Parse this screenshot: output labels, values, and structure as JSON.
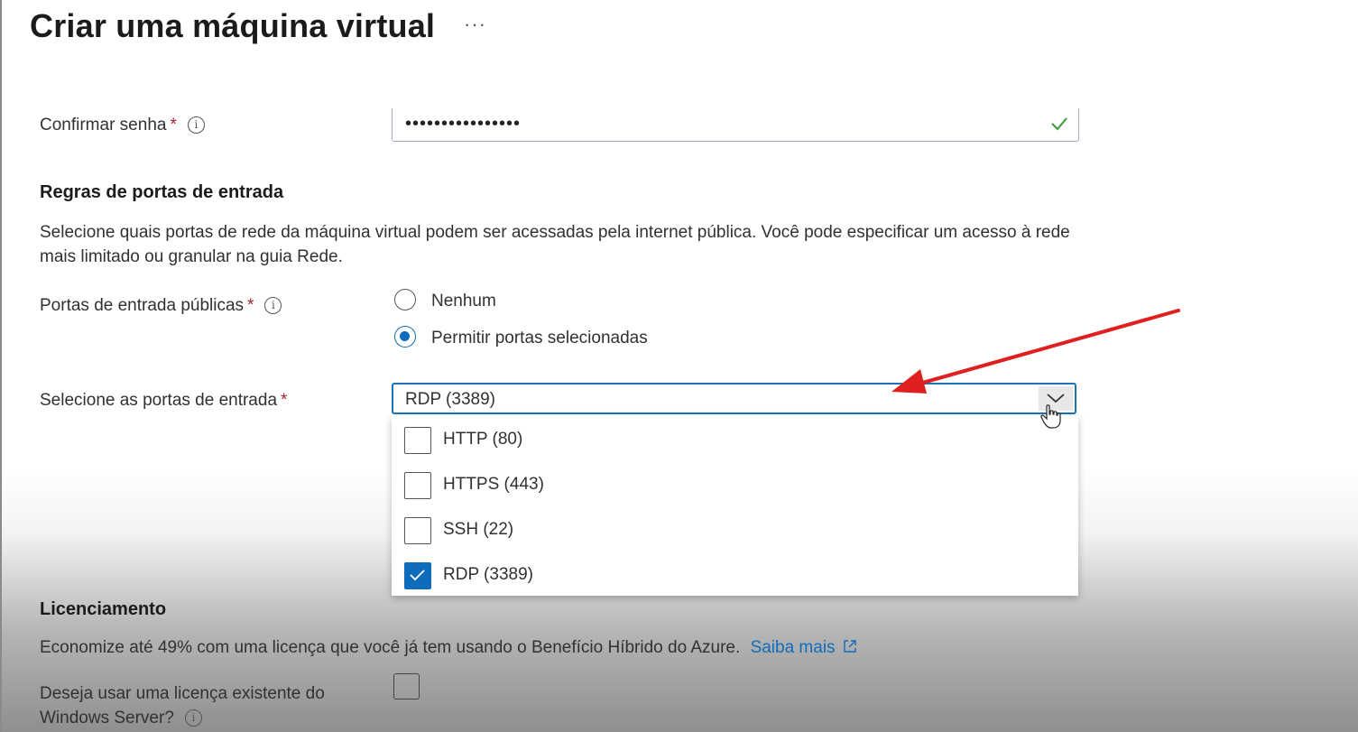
{
  "page": {
    "title": "Criar uma máquina virtual",
    "more_glyph": "···"
  },
  "confirm_password": {
    "label": "Confirmar senha",
    "required_mark": "*",
    "info_glyph": "i",
    "value": "••••••••••••••••"
  },
  "inbound_rules": {
    "heading": "Regras de portas de entrada",
    "description": "Selecione quais portas de rede da máquina virtual podem ser acessadas pela internet pública. Você pode especificar um acesso à rede mais limitado ou granular na guia Rede.",
    "public_ports": {
      "label": "Portas de entrada públicas",
      "required_mark": "*",
      "info_glyph": "i",
      "options": [
        {
          "label": "Nenhum",
          "selected": false
        },
        {
          "label": "Permitir portas selecionadas",
          "selected": true
        }
      ]
    },
    "select_ports": {
      "label": "Selecione as portas de entrada",
      "required_mark": "*",
      "value": "RDP (3389)",
      "items": [
        {
          "label": "HTTP (80)",
          "checked": false
        },
        {
          "label": "HTTPS (443)",
          "checked": false
        },
        {
          "label": "SSH (22)",
          "checked": false
        },
        {
          "label": "RDP (3389)",
          "checked": true
        }
      ]
    }
  },
  "licensing": {
    "heading": "Licenciamento",
    "description": "Economize até 49% com uma licença que você já tem usando o Benefício Híbrido do Azure.",
    "link": "Saiba mais",
    "question_line1": "Deseja usar uma licença existente do",
    "question_line2": "Windows Server?",
    "info_glyph": "i",
    "checked": false
  },
  "colors": {
    "accent": "#0f6cbd",
    "required": "#a4262c",
    "annotation_arrow": "#e02020",
    "valid_check": "#3a9a3a"
  }
}
